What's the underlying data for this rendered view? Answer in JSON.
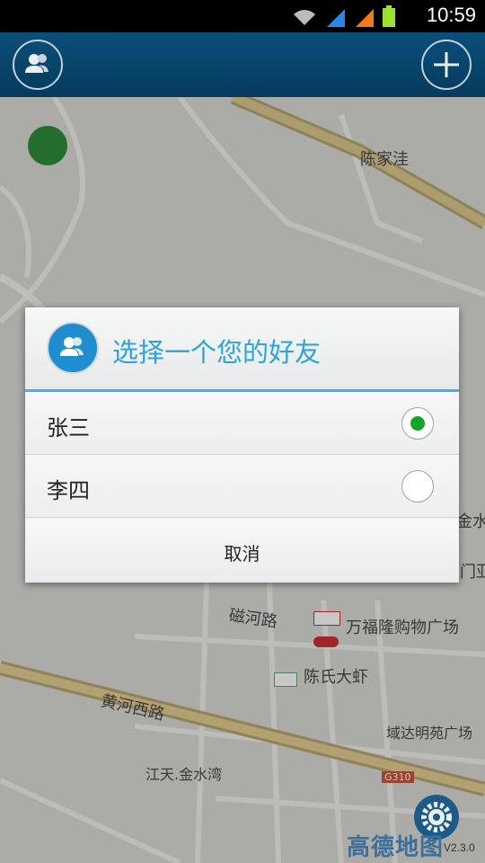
{
  "status_bar": {
    "time": "10:59"
  },
  "map": {
    "labels": [
      "陈家洼",
      "磁河路",
      "万福隆购物广场",
      "陈氏大虾",
      "黄河西路",
      "域达明苑广场",
      "江天.金水湾",
      "G310",
      "金水",
      "门亚"
    ],
    "logo": "高德地图",
    "version": "V2.3.0"
  },
  "dialog": {
    "title": "选择一个您的好友",
    "options": [
      {
        "label": "张三",
        "selected": true
      },
      {
        "label": "李四",
        "selected": false
      }
    ],
    "cancel_label": "取消"
  },
  "colors": {
    "accent": "#2ea2d8",
    "radio_selected": "#12a528",
    "topbar": "#0a4f7b"
  }
}
